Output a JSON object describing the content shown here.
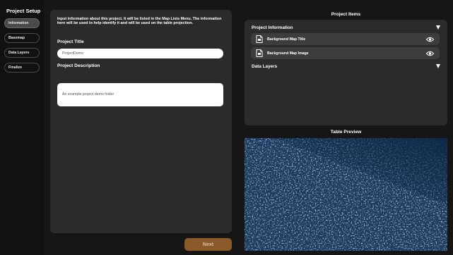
{
  "sidebar": {
    "title": "Project Setup",
    "steps": [
      {
        "label": "Information",
        "active": true
      },
      {
        "label": "Basemap",
        "active": false
      },
      {
        "label": "Data Layers",
        "active": false
      },
      {
        "label": "Finalize",
        "active": false
      }
    ]
  },
  "form": {
    "intro": "Input information about this project. It will be listed in the Map Lists Menu. The information here will be used to help identify it and will be used on the table projection.",
    "title_label": "Project Title",
    "title_value": "ProjectDemo",
    "description_label": "Project Description",
    "description_value": "An example project demo folder"
  },
  "next_label": "Next",
  "project_items": {
    "header": "Project Items",
    "sections": [
      {
        "label": "Project Information",
        "items": [
          {
            "label": "Background Map Title"
          },
          {
            "label": "Background Map Image"
          }
        ]
      },
      {
        "label": "Data Layers",
        "items": []
      }
    ]
  },
  "preview": {
    "header": "Table Preview"
  },
  "colors": {
    "background": "#161616",
    "panel": "#2b2b2b",
    "item_row": "#3d3d3d",
    "next_button": "#8a5a2a",
    "preview_water": "#0f2a48"
  }
}
